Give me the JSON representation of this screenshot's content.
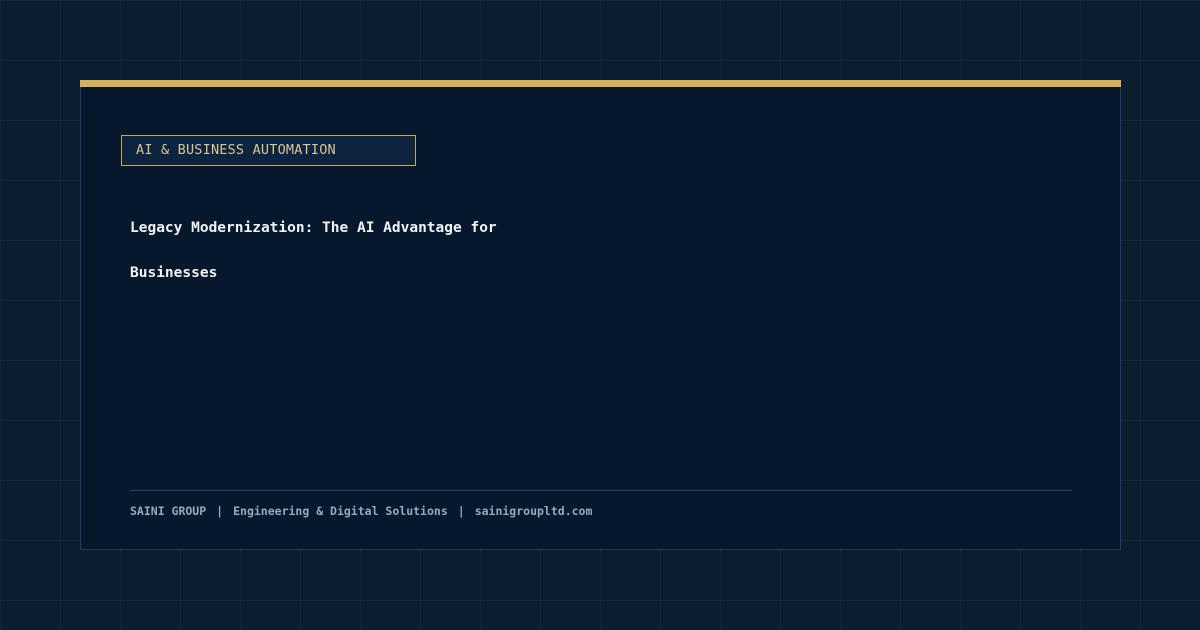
{
  "card": {
    "category": "AI & BUSINESS AUTOMATION",
    "headline": "Legacy Modernization: The AI Advantage for Businesses"
  },
  "footer": {
    "company": "SAINI GROUP",
    "separator": "|",
    "tagline": "Engineering & Digital Solutions",
    "website": "sainigroupltd.com"
  },
  "colors": {
    "background": "#0b1d2e",
    "card": "#07172c",
    "accent_gold": "#d6b158",
    "headline_text": "#f1f3f6",
    "footer_text": "#9aa9bb"
  }
}
